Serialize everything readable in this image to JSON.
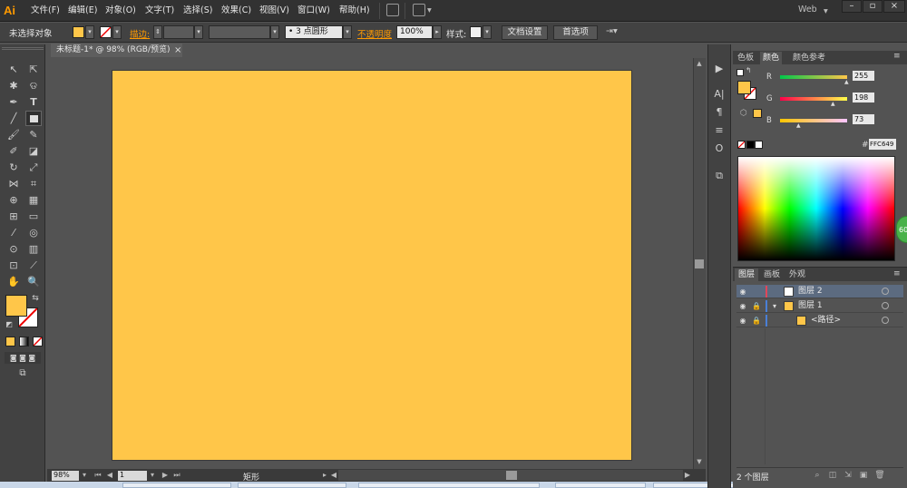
{
  "app": {
    "logo": "Ai"
  },
  "menu": {
    "items": [
      "文件(F)",
      "编辑(E)",
      "对象(O)",
      "文字(T)",
      "选择(S)",
      "效果(C)",
      "视图(V)",
      "窗口(W)",
      "帮助(H)"
    ],
    "workspace": "Web"
  },
  "control_bar": {
    "selection_status": "未选择对象",
    "stroke_label": "描边:",
    "brush_value": "3 点圆形",
    "opacity_label": "不透明度",
    "opacity_value": "100%",
    "style_label": "样式:",
    "doc_setup_button": "文档设置",
    "preferences_button": "首选项"
  },
  "document": {
    "tab_title": "未标题-1* @ 98% (RGB/预览)",
    "tab_close": "×"
  },
  "status_bar": {
    "zoom": "98%",
    "artboard_number": "1",
    "current_tool": "矩形"
  },
  "color_panel": {
    "tabs": [
      "色板",
      "颜色",
      "颜色参考"
    ],
    "active_tab": "颜色",
    "channels": [
      {
        "label": "R",
        "value": "255"
      },
      {
        "label": "G",
        "value": "198"
      },
      {
        "label": "B",
        "value": "73"
      }
    ],
    "hex_label": "#",
    "hex_value": "FFC649",
    "fill_color": "#ffc649",
    "badge_text": "60"
  },
  "layers_panel": {
    "tabs": [
      "图层",
      "画板",
      "外观"
    ],
    "layers": [
      {
        "name": "图层 2",
        "color": "#e0475a",
        "thumb": "#ffffff"
      },
      {
        "name": "图层 1",
        "color": "#4a7fd6",
        "thumb": "#ffc649"
      },
      {
        "name": "<路径>",
        "color": "#4a7fd6",
        "thumb": "#ffc649"
      }
    ],
    "count": "2 个图层"
  },
  "colors": {
    "artboard": "#ffc649",
    "accent": "#ff9a00",
    "ui_bg": "#535353"
  }
}
